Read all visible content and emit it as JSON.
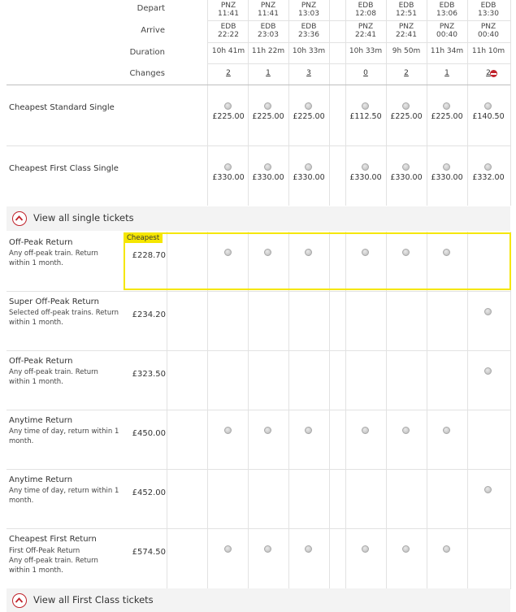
{
  "header_labels": {
    "depart": "Depart",
    "arrive": "Arrive",
    "duration": "Duration",
    "changes": "Changes"
  },
  "journeys": [
    {
      "dep_station": "PNZ",
      "dep_time": "11:41",
      "arr_station": "EDB",
      "arr_time": "22:22",
      "duration": "10h 41m",
      "changes": "2"
    },
    {
      "dep_station": "PNZ",
      "dep_time": "11:41",
      "arr_station": "EDB",
      "arr_time": "23:03",
      "duration": "11h 22m",
      "changes": "1"
    },
    {
      "dep_station": "PNZ",
      "dep_time": "13:03",
      "arr_station": "EDB",
      "arr_time": "23:36",
      "duration": "10h 33m",
      "changes": "3"
    },
    {
      "dep_station": "EDB",
      "dep_time": "12:08",
      "arr_station": "PNZ",
      "arr_time": "22:41",
      "duration": "10h 33m",
      "changes": "0"
    },
    {
      "dep_station": "EDB",
      "dep_time": "12:51",
      "arr_station": "PNZ",
      "arr_time": "22:41",
      "duration": "9h 50m",
      "changes": "2"
    },
    {
      "dep_station": "EDB",
      "dep_time": "13:06",
      "arr_station": "PNZ",
      "arr_time": "00:40",
      "duration": "11h 34m",
      "changes": "1"
    },
    {
      "dep_station": "EDB",
      "dep_time": "13:30",
      "arr_station": "PNZ",
      "arr_time": "00:40",
      "duration": "11h 10m",
      "changes": "2"
    }
  ],
  "singles": [
    {
      "title": "Cheapest Standard Single",
      "prices": [
        "£225.00",
        "£225.00",
        "£225.00",
        "£112.50",
        "£225.00",
        "£225.00",
        "£140.50"
      ]
    },
    {
      "title": "Cheapest First Class Single",
      "prices": [
        "£330.00",
        "£330.00",
        "£330.00",
        "£330.00",
        "£330.00",
        "£330.00",
        "£332.00"
      ]
    }
  ],
  "view_singles_label": "View all single tickets",
  "cheapest_badge": "Cheapest",
  "returns": [
    {
      "title": "Off-Peak Return",
      "subtitle": "",
      "desc": "Any off-peak train. Return within 1 month.",
      "price": "£228.70",
      "radios": [
        true,
        true,
        true,
        true,
        true,
        true,
        false
      ]
    },
    {
      "title": "Super Off-Peak Return",
      "subtitle": "",
      "desc": "Selected off-peak trains. Return within 1 month.",
      "price": "£234.20",
      "radios": [
        false,
        false,
        false,
        false,
        false,
        false,
        true
      ]
    },
    {
      "title": "Off-Peak Return",
      "subtitle": "",
      "desc": "Any off-peak train. Return within 1 month.",
      "price": "£323.50",
      "radios": [
        false,
        false,
        false,
        false,
        false,
        false,
        true
      ]
    },
    {
      "title": "Anytime Return",
      "subtitle": "",
      "desc": "Any time of day, return within 1 month.",
      "price": "£450.00",
      "radios": [
        true,
        true,
        true,
        true,
        true,
        true,
        false
      ]
    },
    {
      "title": "Anytime Return",
      "subtitle": "",
      "desc": "Any time of day, return within 1 month.",
      "price": "£452.00",
      "radios": [
        false,
        false,
        false,
        false,
        false,
        false,
        true
      ]
    },
    {
      "title": "Cheapest First Return",
      "subtitle": "First Off-Peak Return",
      "desc": "Any off-peak train. Return within 1 month.",
      "price": "£574.50",
      "radios": [
        true,
        true,
        true,
        true,
        true,
        true,
        false
      ]
    }
  ],
  "view_first_label": "View all First Class tickets",
  "colors": {
    "accent_red": "#c0232b",
    "highlight_yellow": "#f5e600",
    "grid": "#e2e2e2"
  }
}
